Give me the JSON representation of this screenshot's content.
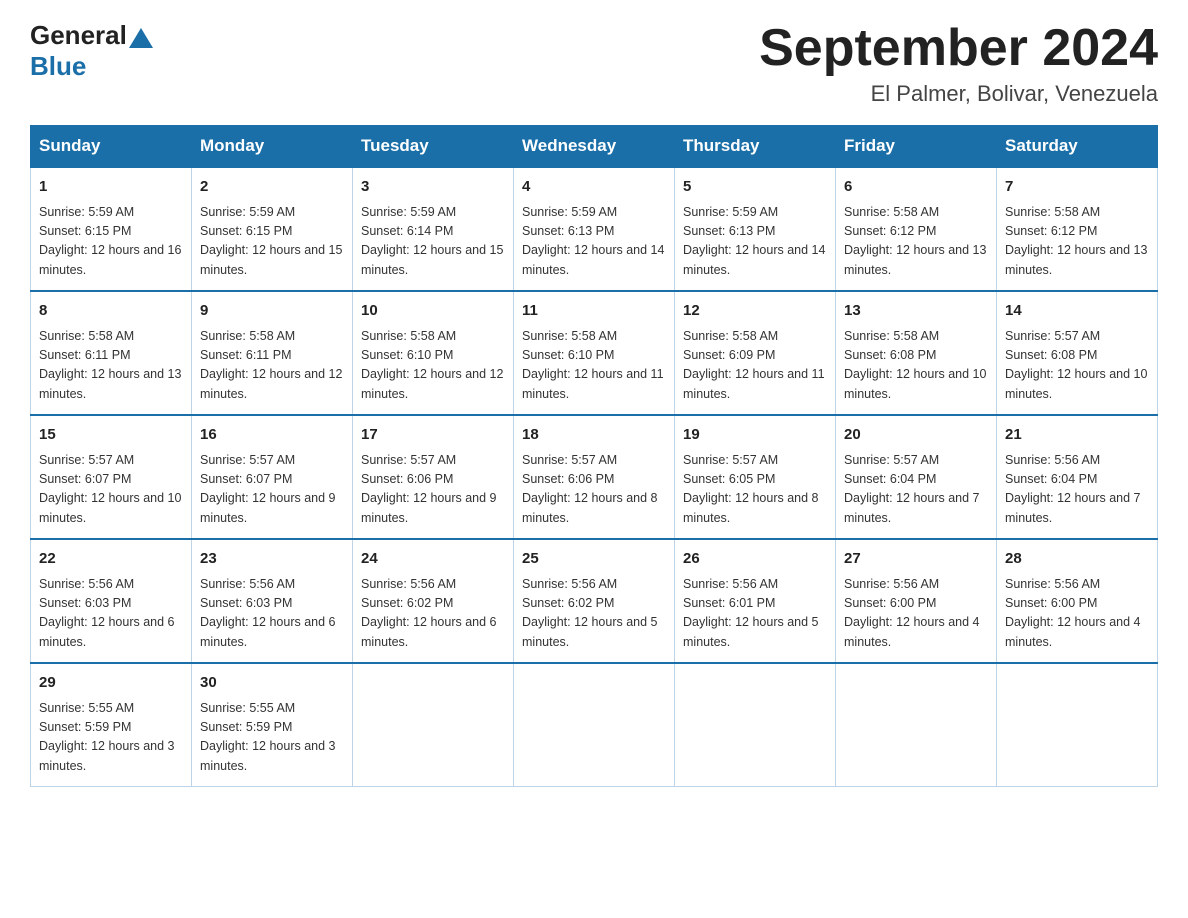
{
  "header": {
    "logo_general": "General",
    "logo_blue": "Blue",
    "month_title": "September 2024",
    "location": "El Palmer, Bolivar, Venezuela"
  },
  "days_of_week": [
    "Sunday",
    "Monday",
    "Tuesday",
    "Wednesday",
    "Thursday",
    "Friday",
    "Saturday"
  ],
  "weeks": [
    [
      {
        "num": "1",
        "sunrise": "5:59 AM",
        "sunset": "6:15 PM",
        "daylight": "12 hours and 16 minutes."
      },
      {
        "num": "2",
        "sunrise": "5:59 AM",
        "sunset": "6:15 PM",
        "daylight": "12 hours and 15 minutes."
      },
      {
        "num": "3",
        "sunrise": "5:59 AM",
        "sunset": "6:14 PM",
        "daylight": "12 hours and 15 minutes."
      },
      {
        "num": "4",
        "sunrise": "5:59 AM",
        "sunset": "6:13 PM",
        "daylight": "12 hours and 14 minutes."
      },
      {
        "num": "5",
        "sunrise": "5:59 AM",
        "sunset": "6:13 PM",
        "daylight": "12 hours and 14 minutes."
      },
      {
        "num": "6",
        "sunrise": "5:58 AM",
        "sunset": "6:12 PM",
        "daylight": "12 hours and 13 minutes."
      },
      {
        "num": "7",
        "sunrise": "5:58 AM",
        "sunset": "6:12 PM",
        "daylight": "12 hours and 13 minutes."
      }
    ],
    [
      {
        "num": "8",
        "sunrise": "5:58 AM",
        "sunset": "6:11 PM",
        "daylight": "12 hours and 13 minutes."
      },
      {
        "num": "9",
        "sunrise": "5:58 AM",
        "sunset": "6:11 PM",
        "daylight": "12 hours and 12 minutes."
      },
      {
        "num": "10",
        "sunrise": "5:58 AM",
        "sunset": "6:10 PM",
        "daylight": "12 hours and 12 minutes."
      },
      {
        "num": "11",
        "sunrise": "5:58 AM",
        "sunset": "6:10 PM",
        "daylight": "12 hours and 11 minutes."
      },
      {
        "num": "12",
        "sunrise": "5:58 AM",
        "sunset": "6:09 PM",
        "daylight": "12 hours and 11 minutes."
      },
      {
        "num": "13",
        "sunrise": "5:58 AM",
        "sunset": "6:08 PM",
        "daylight": "12 hours and 10 minutes."
      },
      {
        "num": "14",
        "sunrise": "5:57 AM",
        "sunset": "6:08 PM",
        "daylight": "12 hours and 10 minutes."
      }
    ],
    [
      {
        "num": "15",
        "sunrise": "5:57 AM",
        "sunset": "6:07 PM",
        "daylight": "12 hours and 10 minutes."
      },
      {
        "num": "16",
        "sunrise": "5:57 AM",
        "sunset": "6:07 PM",
        "daylight": "12 hours and 9 minutes."
      },
      {
        "num": "17",
        "sunrise": "5:57 AM",
        "sunset": "6:06 PM",
        "daylight": "12 hours and 9 minutes."
      },
      {
        "num": "18",
        "sunrise": "5:57 AM",
        "sunset": "6:06 PM",
        "daylight": "12 hours and 8 minutes."
      },
      {
        "num": "19",
        "sunrise": "5:57 AM",
        "sunset": "6:05 PM",
        "daylight": "12 hours and 8 minutes."
      },
      {
        "num": "20",
        "sunrise": "5:57 AM",
        "sunset": "6:04 PM",
        "daylight": "12 hours and 7 minutes."
      },
      {
        "num": "21",
        "sunrise": "5:56 AM",
        "sunset": "6:04 PM",
        "daylight": "12 hours and 7 minutes."
      }
    ],
    [
      {
        "num": "22",
        "sunrise": "5:56 AM",
        "sunset": "6:03 PM",
        "daylight": "12 hours and 6 minutes."
      },
      {
        "num": "23",
        "sunrise": "5:56 AM",
        "sunset": "6:03 PM",
        "daylight": "12 hours and 6 minutes."
      },
      {
        "num": "24",
        "sunrise": "5:56 AM",
        "sunset": "6:02 PM",
        "daylight": "12 hours and 6 minutes."
      },
      {
        "num": "25",
        "sunrise": "5:56 AM",
        "sunset": "6:02 PM",
        "daylight": "12 hours and 5 minutes."
      },
      {
        "num": "26",
        "sunrise": "5:56 AM",
        "sunset": "6:01 PM",
        "daylight": "12 hours and 5 minutes."
      },
      {
        "num": "27",
        "sunrise": "5:56 AM",
        "sunset": "6:00 PM",
        "daylight": "12 hours and 4 minutes."
      },
      {
        "num": "28",
        "sunrise": "5:56 AM",
        "sunset": "6:00 PM",
        "daylight": "12 hours and 4 minutes."
      }
    ],
    [
      {
        "num": "29",
        "sunrise": "5:55 AM",
        "sunset": "5:59 PM",
        "daylight": "12 hours and 3 minutes."
      },
      {
        "num": "30",
        "sunrise": "5:55 AM",
        "sunset": "5:59 PM",
        "daylight": "12 hours and 3 minutes."
      },
      null,
      null,
      null,
      null,
      null
    ]
  ]
}
